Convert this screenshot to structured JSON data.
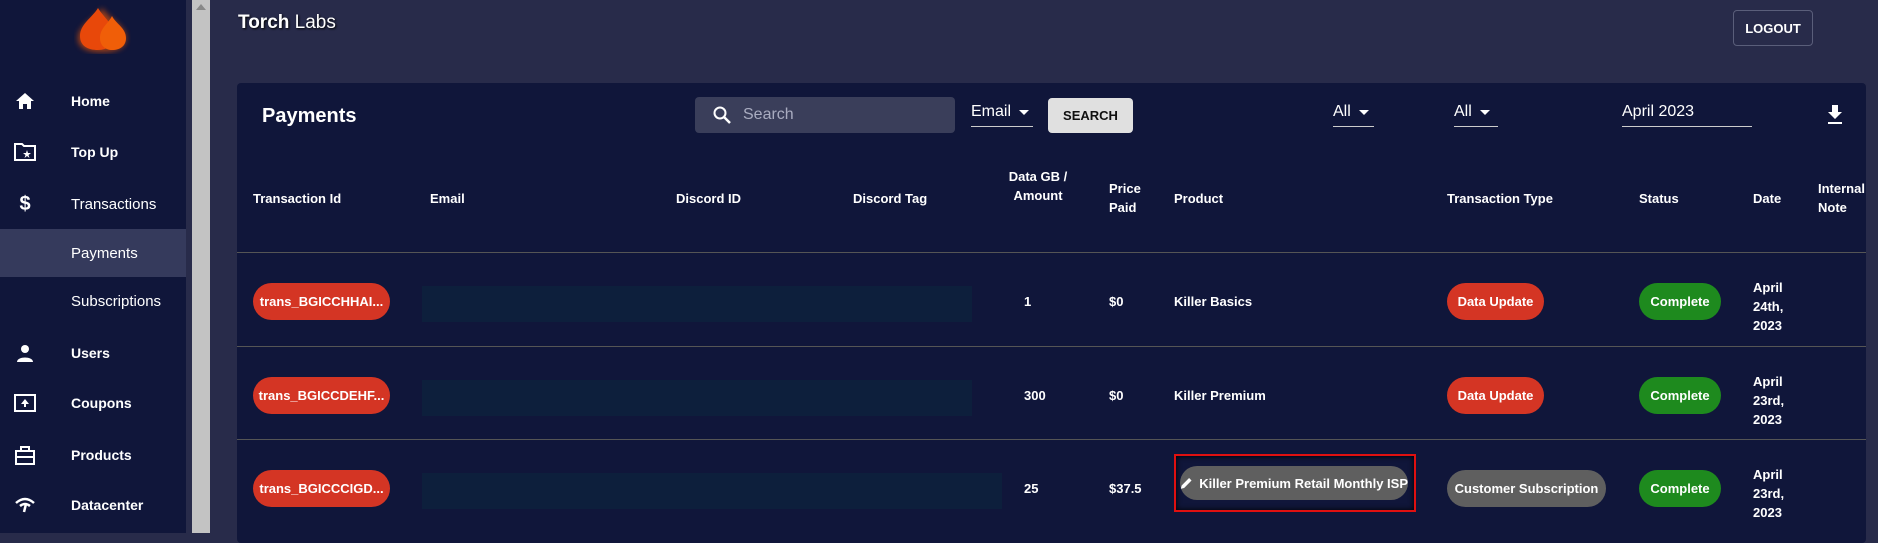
{
  "app": {
    "title_bold": "Torch",
    "title_rest": " Labs",
    "logout": "LOGOUT"
  },
  "sidebar": {
    "items": [
      {
        "label": "Home",
        "icon": "home-icon"
      },
      {
        "label": "Top Up",
        "icon": "folder-star-icon"
      },
      {
        "label": "Transactions",
        "icon": "dollar-icon"
      },
      {
        "label": "Payments",
        "icon": ""
      },
      {
        "label": "Subscriptions",
        "icon": ""
      },
      {
        "label": "Users",
        "icon": "user-icon"
      },
      {
        "label": "Coupons",
        "icon": "upload-box-icon"
      },
      {
        "label": "Products",
        "icon": "briefcase-icon"
      },
      {
        "label": "Datacenter",
        "icon": "wifi-icon"
      }
    ]
  },
  "payments": {
    "heading": "Payments",
    "search_placeholder": "Search",
    "search_field": "Email",
    "search_button": "SEARCH",
    "filter1": "All",
    "filter2": "All",
    "month": "April 2023"
  },
  "table": {
    "headers": [
      "Transaction Id",
      "Email",
      "Discord ID",
      "Discord Tag",
      "Data GB / Amount",
      "Price Paid",
      "Product",
      "Transaction Type",
      "Status",
      "Date",
      "Internal Note"
    ],
    "rows": [
      {
        "id": "trans_BGICCHHAI...",
        "data": "1",
        "price": "$0",
        "product": "Killer Basics",
        "type": "Data Update",
        "status": "Complete",
        "date": "April 24th, 2023"
      },
      {
        "id": "trans_BGICCDEHF...",
        "data": "300",
        "price": "$0",
        "product": "Killer Premium",
        "type": "Data Update",
        "status": "Complete",
        "date": "April 23rd, 2023"
      },
      {
        "id": "trans_BGICCCIGD...",
        "data": "25",
        "price": "$37.5",
        "product": "Killer Premium Retail Monthly ISP",
        "type": "Customer Subscription",
        "status": "Complete",
        "date": "April 23rd, 2023"
      }
    ]
  },
  "colors": {
    "red": "#d43524",
    "green": "#1e8a1e",
    "grey": "#5f5f5f",
    "bg": "#282b4a",
    "panel": "#10163a"
  }
}
